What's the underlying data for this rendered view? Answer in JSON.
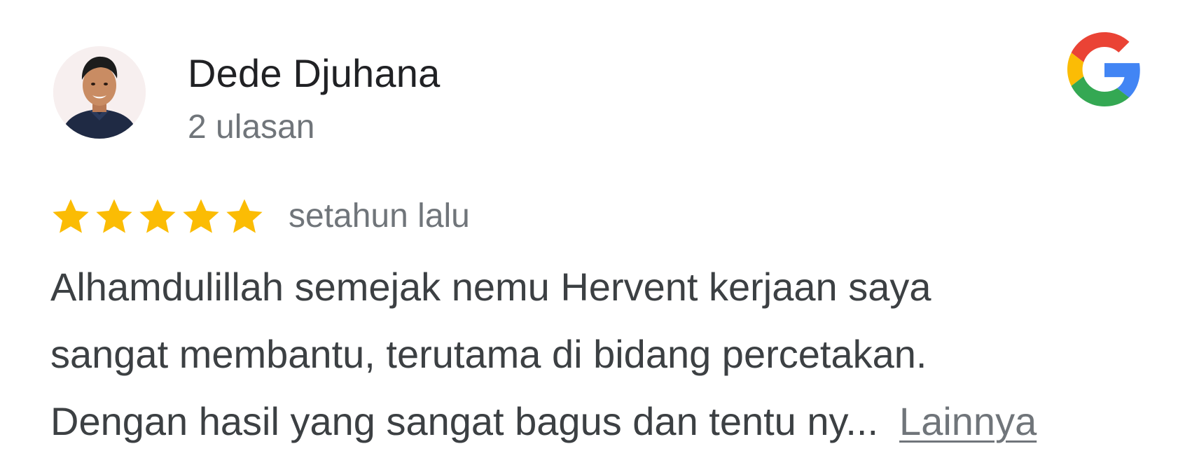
{
  "reviewer": {
    "name": "Dede Djuhana",
    "review_count": "2 ulasan",
    "avatar_icon": "user-photo"
  },
  "brand": {
    "logo_icon": "google-g-logo",
    "colors": {
      "red": "#EA4335",
      "yellow": "#FBBC05",
      "green": "#34A853",
      "blue": "#4285F4"
    }
  },
  "review": {
    "rating": 5,
    "max_rating": 5,
    "star_color": "#FBBC04",
    "time_ago": "setahun lalu",
    "text_lines": [
      "Alhamdulillah semejak nemu Hervent kerjaan saya",
      "sangat membantu, terutama di bidang percetakan.",
      "Dengan hasil yang sangat bagus dan tentu ny..."
    ],
    "more_label": "Lainnya"
  }
}
